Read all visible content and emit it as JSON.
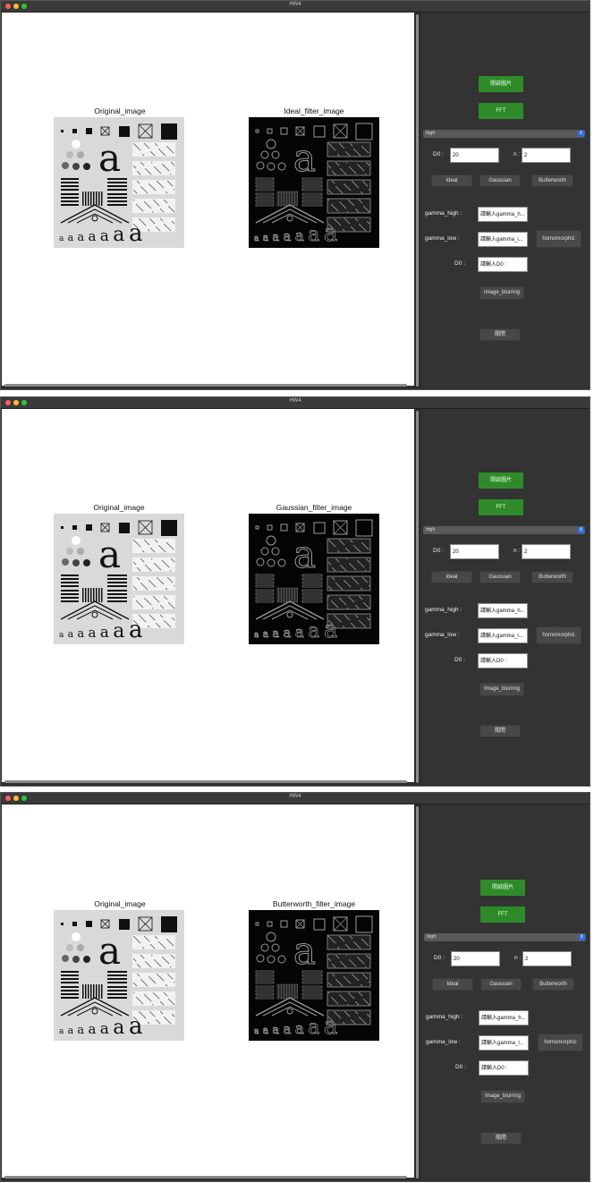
{
  "windows": [
    {
      "title": "HW4",
      "plots": [
        {
          "title": "Original_image",
          "kind": "original"
        },
        {
          "title": "Ideal_filter_image",
          "kind": "filtered"
        }
      ]
    },
    {
      "title": "HW4",
      "plots": [
        {
          "title": "Original_image",
          "kind": "original"
        },
        {
          "title": "Gaussian_filter_image",
          "kind": "filtered"
        }
      ]
    },
    {
      "title": "HW4",
      "plots": [
        {
          "title": "Original_image",
          "kind": "original"
        },
        {
          "title": "Butterworth_filter_image",
          "kind": "filtered"
        }
      ]
    }
  ],
  "panel": {
    "open_button": "開啟圖片",
    "fft_button": "FFT",
    "filter_select": "high",
    "d0_label": "D0 :",
    "d0_value": "20",
    "n_label": "n :",
    "n_value": "2",
    "ideal_button": "Ideal",
    "gaussian_button": "Gaussian",
    "butterworth_button": "Butterworth",
    "gamma_high_label": "gamma_high :",
    "gamma_high_placeholder": "請輸入gamma_h...",
    "gamma_low_label": "gamma_low :",
    "gamma_low_placeholder": "請輸入gamma_l...",
    "homomorphic_button": "homomorphic",
    "d0b_label": "D0 :",
    "d0b_placeholder": "請輸入D0 :",
    "blurring_button": "Image_blurring",
    "close_button": "關閉"
  },
  "colors": {
    "accent_green": "#2f8b2a",
    "panel_bg": "#333333",
    "select_arrow": "#2d6ff0"
  }
}
